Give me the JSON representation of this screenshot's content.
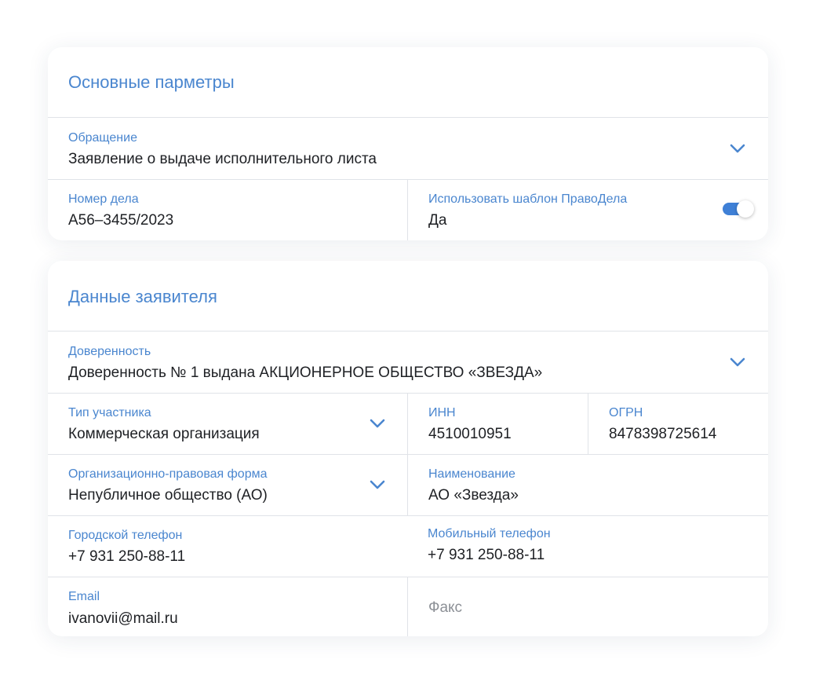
{
  "colors": {
    "accent": "#4a86cf",
    "toggle_on": "#3f80d6",
    "text": "#1e2024",
    "placeholder": "#8c9096",
    "divider": "#e0e3e8"
  },
  "main_params": {
    "title": "Основные парметры",
    "appeal": {
      "label": "Обращение",
      "value": "Заявление о выдаче исполнительного листа",
      "icon": "chevron-down-icon"
    },
    "case_number": {
      "label": "Номер дела",
      "value": "А56–3455/2023"
    },
    "use_template": {
      "label": "Использовать шаблон ПравоДела",
      "value": "Да",
      "toggle_on": true
    }
  },
  "applicant": {
    "title": "Данные заявителя",
    "power_of_attorney": {
      "label": "Доверенность",
      "value": "Доверенность № 1 выдана АКЦИОНЕРНОЕ ОБЩЕСТВО «ЗВЕЗДА»",
      "icon": "chevron-down-icon"
    },
    "participant_type": {
      "label": "Тип участника",
      "value": "Коммерческая организация",
      "icon": "chevron-down-icon"
    },
    "inn": {
      "label": "ИНН",
      "value": "4510010951"
    },
    "ogrn": {
      "label": "ОГРН",
      "value": "8478398725614"
    },
    "legal_form": {
      "label": "Организационно-правовая форма",
      "value": "Непубличное общество (АО)",
      "icon": "chevron-down-icon"
    },
    "name": {
      "label": "Наименование",
      "value": "АО «Звезда»"
    },
    "city_phone": {
      "label": "Городской телефон",
      "value": "+7 931 250-88-11"
    },
    "mobile_phone": {
      "label": "Мобильный телефон",
      "value": "+7 931 250-88-11"
    },
    "email": {
      "label": "Email",
      "value": "ivanovii@mail.ru"
    },
    "fax": {
      "placeholder": "Факс"
    }
  }
}
